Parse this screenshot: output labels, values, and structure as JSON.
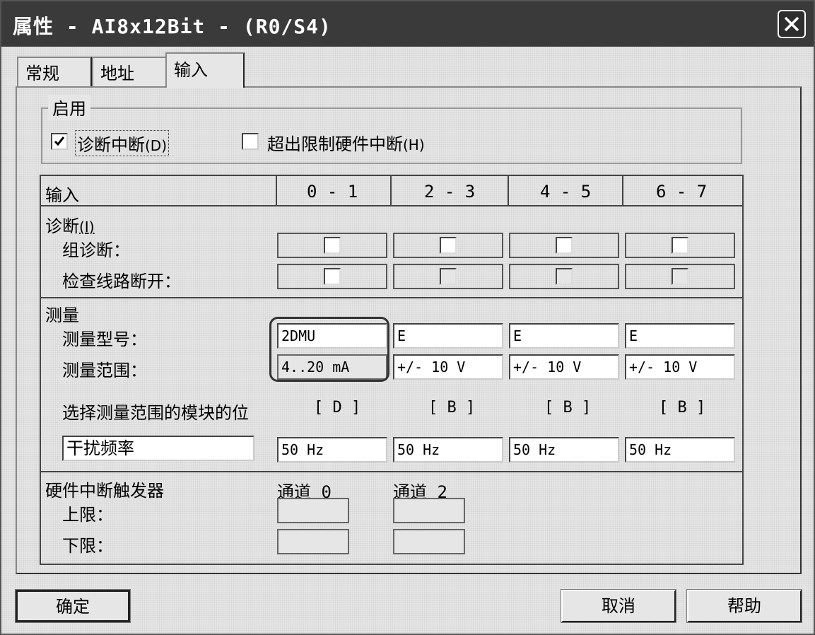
{
  "window": {
    "title": "属性 - AI8x12Bit - (R0/S4)"
  },
  "tabs": [
    {
      "label": "常规"
    },
    {
      "label": "地址"
    },
    {
      "label": "输入",
      "active": true
    }
  ],
  "enable_group": {
    "title": "启用",
    "diag_interrupt": {
      "label": "诊断中断",
      "hotkey": "(D)",
      "checked": true
    },
    "limit_interrupt": {
      "label": "超出限制硬件中断",
      "hotkey": "(H)",
      "checked": false
    }
  },
  "table": {
    "header_label": "输入",
    "columns": [
      "0 - 1",
      "2 - 3",
      "4 - 5",
      "6 - 7"
    ],
    "diagnostics": {
      "title": "诊断",
      "hotkey": "(I)",
      "group_diag_label": "组诊断：",
      "wire_break_label": "检查线路断开："
    },
    "measurement": {
      "title": "测量",
      "type_label": "测量型号：",
      "range_label": "测量范围：",
      "types": [
        "2DMU",
        "E",
        "E",
        "E"
      ],
      "ranges": [
        "4..20 mA",
        "+/- 10 V",
        "+/- 10 V",
        "+/- 10 V"
      ],
      "module_position_label": "选择测量范围的模块的位",
      "module_positions": [
        "[ D ]",
        "[ B ]",
        "[ B ]",
        "[ B ]"
      ],
      "interference_label": "干扰频率",
      "interference": [
        "50 Hz",
        "50 Hz",
        "50 Hz",
        "50 Hz"
      ]
    },
    "hw_trigger": {
      "title": "硬件中断触发器",
      "channel0": "通道 0",
      "channel2": "通道 2",
      "upper_label": "上限：",
      "lower_label": "下限："
    }
  },
  "buttons": {
    "ok": "确定",
    "cancel": "取消",
    "help": "帮助"
  }
}
